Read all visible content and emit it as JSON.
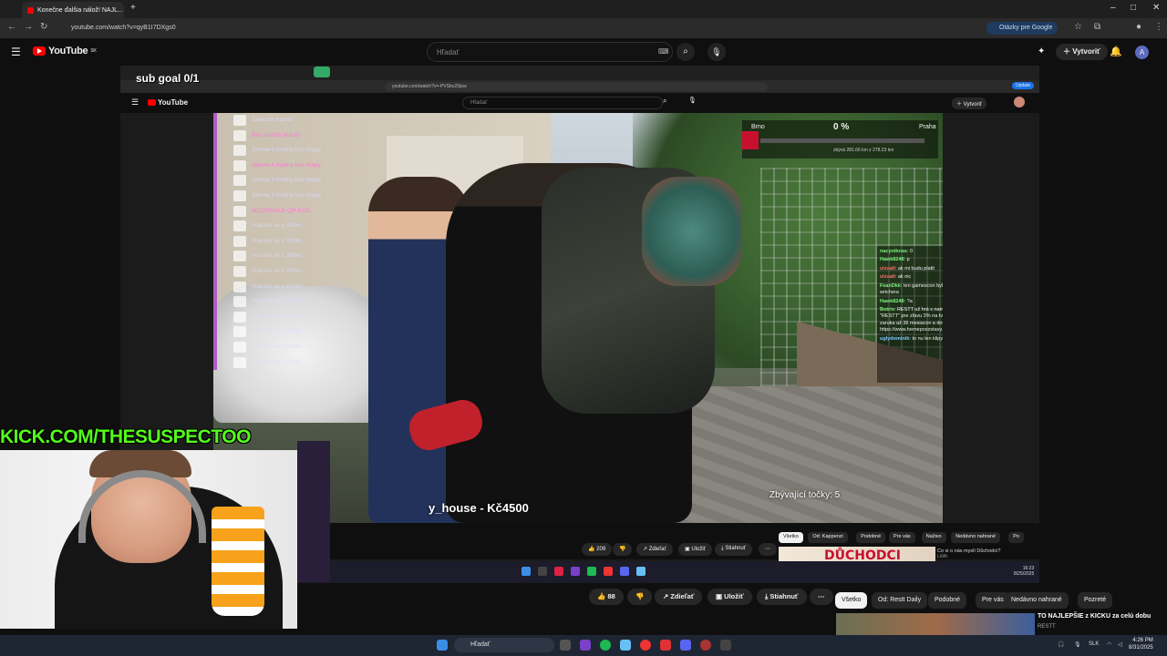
{
  "browser": {
    "tab_title": "Konečne ďalšia nálož! NAJL...",
    "url": "youtube.com/watch?v=qyB1I7DXgs0",
    "google_questions": "Otázky pre Google"
  },
  "yt": {
    "logo": "YouTube",
    "logo_sup": "SK",
    "search_placeholder": "Hľadať",
    "create": "Vytvoriť",
    "avatar_letter": "A"
  },
  "inner": {
    "sub_goal": "sub goal 0/1",
    "url": "youtube.com/watch?v=-PVSbcZ6ipw",
    "search_placeholder": "Hľadať",
    "create": "Vytvoriť",
    "update": "Update",
    "race": {
      "from": "Brno",
      "to": "Praha",
      "percent": "0 %",
      "meta": "zbývá 281.66 km z 278.23 km"
    },
    "tasks": [
      {
        "label": "Zakázán hadřík",
        "hl": false
      },
      {
        "label": "Bez mobilů (Kouli)",
        "hl": true
      },
      {
        "label": "Jdeme 4 hodiny bez mapy",
        "hl": false
      },
      {
        "label": "Jdeme 4 hodiny bez mapy",
        "hl": true
      },
      {
        "label": "Jdeme 2 hodiny bez mapy",
        "hl": false
      },
      {
        "label": "Jdeme 2 hodiny bez mapy",
        "hl": false
      },
      {
        "label": "MCDONALD QR KOD",
        "hl": true
      },
      {
        "label": "Vracení se o 300m",
        "hl": false
      },
      {
        "label": "Vracení se o 300m",
        "hl": false
      },
      {
        "label": "Vracení se o 300m",
        "hl": false
      },
      {
        "label": "Vracení se o 300m",
        "hl": false
      },
      {
        "label": "Vracení se o 100m",
        "hl": false
      },
      {
        "label": "Vracení se o 300m",
        "hl": false
      },
      {
        "label": "Vracení se o 100m",
        "hl": false
      },
      {
        "label": "Vracení se o 300m",
        "hl": false
      },
      {
        "label": "Vracení se o 100m",
        "hl": false
      },
      {
        "label": "Vracení se o 100m",
        "hl": false
      }
    ],
    "chat": [
      {
        "user": "nacyniknas",
        "cls": "",
        "text": "0"
      },
      {
        "user": "Hawk8248",
        "cls": "",
        "text": "p"
      },
      {
        "user": "vizuall",
        "cls": "r",
        "text": "ak mi budu platit"
      },
      {
        "user": "vizuall",
        "cls": "r",
        "text": "ak nic"
      },
      {
        "user": "FeanDkk",
        "cls": "",
        "text": "ten gamescon byla taková pacovina až na wrichera"
      },
      {
        "user": "Hawk8248",
        "cls": "",
        "text": "?a"
      },
      {
        "user": "Botrix",
        "cls": "",
        "text": "RESTT už hrá s nami, pridaj sa aj ty! Využi kód \"RESTT\" pre zľavu 3% na tvoju novú hernú zostavu — zaruka až 36 mesiacov a doručenie priamo k tebe. https://www.herneposzstavy.sk/"
      },
      {
        "user": "uglydominik",
        "cls": "b",
        "text": "to nu len klipy tychto kktov? @restt"
      }
    ],
    "bounty": "y_house - Kč4500",
    "points": "Zbývající točky: 5",
    "likes": "209",
    "share": "Zdieľať",
    "save": "Uložiť",
    "download": "Stiahnuť",
    "chips": [
      "Všetko",
      "Od: Kappenzi",
      "Podobné",
      "Pre vás",
      "Naživo",
      "Nedávno nahrané",
      "Po"
    ],
    "rec_big": "DŮCHODCI",
    "rec_title": "Co si o nás myslí Důchodci?",
    "rec_channel": "Lilith",
    "clock_time": "16:23",
    "clock_date": "8/25/2025"
  },
  "overlay": {
    "kick": "KICK.COM/THESUSPECTOO"
  },
  "actions": {
    "likes": "88",
    "share": "Zdieľať",
    "save": "Uložiť",
    "download": "Stiahnuť",
    "chips": [
      "Všetko",
      "Od: Restt Daily",
      "Podobné",
      "Pre vás",
      "Nedávno nahrané",
      "Pozreté"
    ],
    "rec_title": "TO NAJLEPŠIE z KICKU za celú dobu",
    "rec_channel": "RESTT"
  },
  "taskbar": {
    "search": "Hľadať",
    "lang": "SLK",
    "time": "4:26 PM",
    "date": "8/31/2025"
  }
}
